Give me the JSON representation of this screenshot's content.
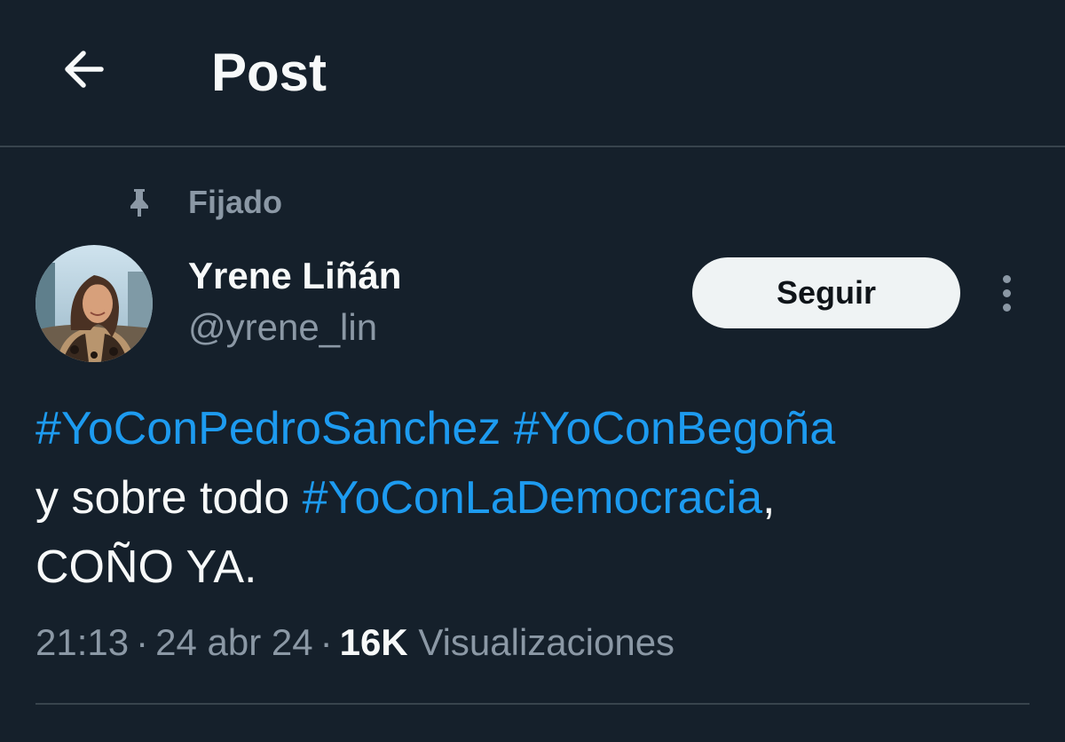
{
  "header": {
    "title": "Post",
    "back_icon": "arrow-left-icon"
  },
  "pinned": {
    "label": "Fijado",
    "icon": "pin-icon"
  },
  "author": {
    "name": "Yrene Liñán",
    "handle": "@yrene_lin",
    "follow_label": "Seguir",
    "more_icon": "more-vertical-icon"
  },
  "tweet": {
    "line1": {
      "hashtag1": "#YoConPedroSanchez",
      "space": " ",
      "hashtag2": "#YoConBegoña"
    },
    "line2": {
      "prefix": "y sobre todo ",
      "hashtag3": "#YoConLaDemocracia",
      "suffix": ","
    },
    "line3": "COÑO YA."
  },
  "meta": {
    "time": "21:13",
    "separator": "·",
    "date": "24 abr 24",
    "views_count": "16K",
    "views_label": "Visualizaciones"
  },
  "colors": {
    "background": "#15202b",
    "accent": "#1d9bf0",
    "text_primary": "#f7f9f9",
    "text_secondary": "#8b98a5",
    "divider": "#38444d"
  }
}
